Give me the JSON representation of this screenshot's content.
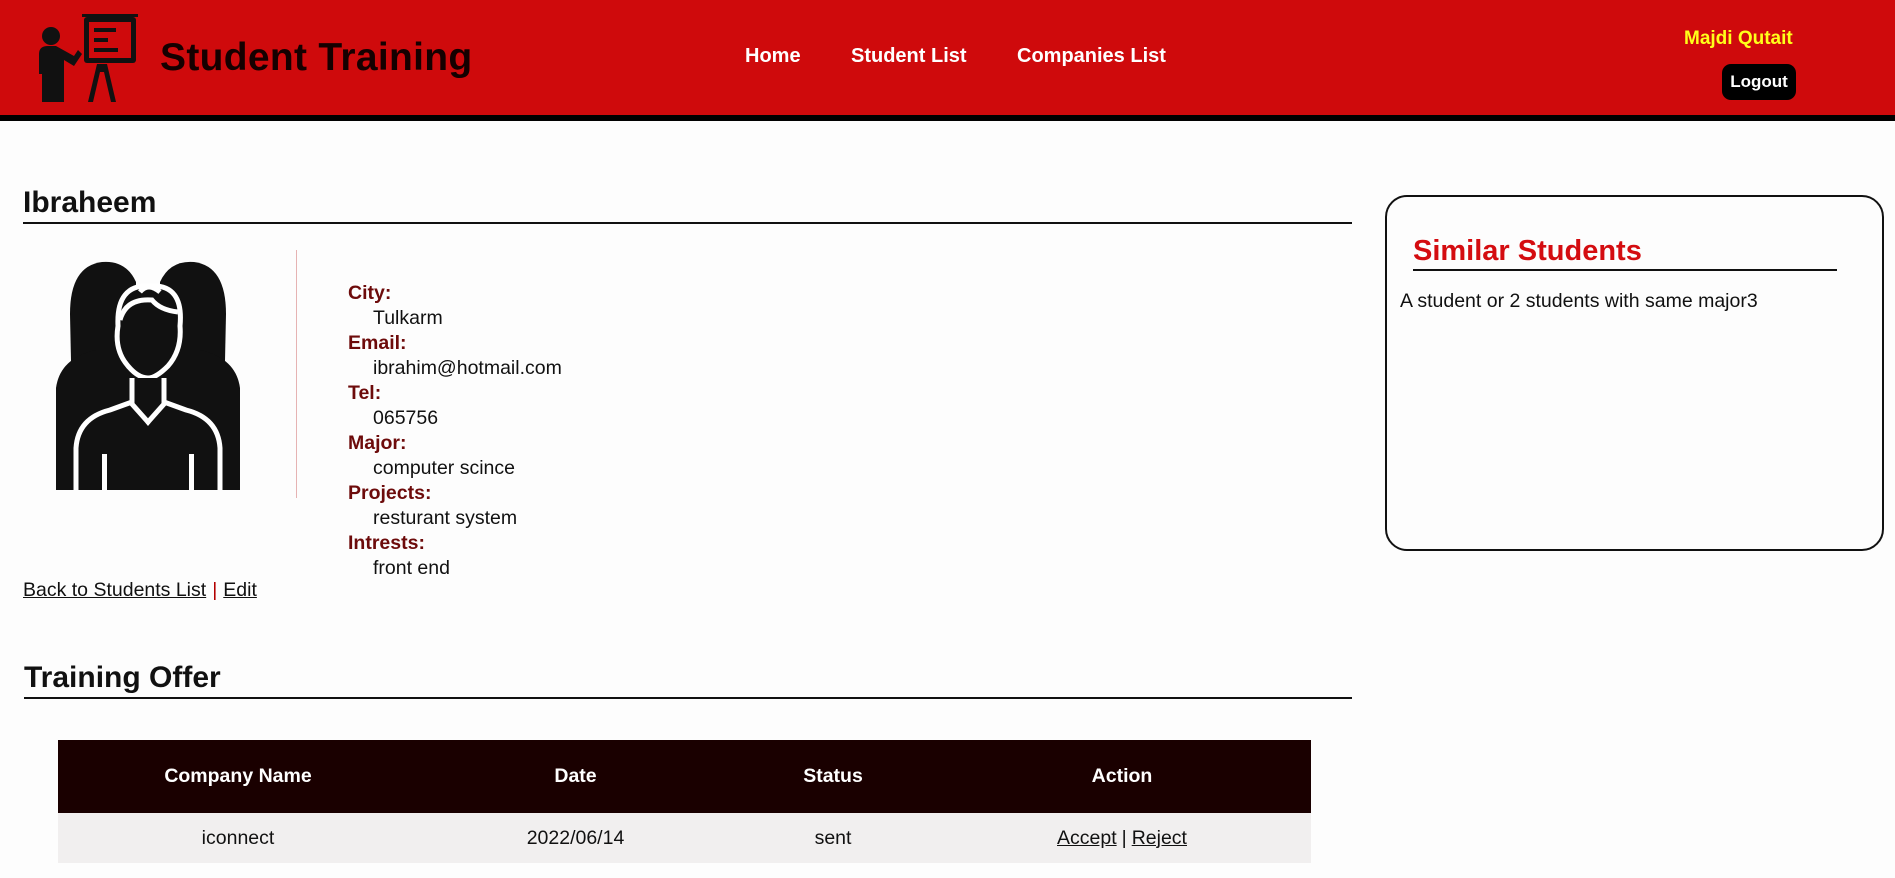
{
  "header": {
    "brand_title": "Student Training",
    "brand_icon": "teacher-presentation-icon",
    "nav": [
      {
        "label": "Home"
      },
      {
        "label": "Student List"
      },
      {
        "label": "Companies List"
      }
    ],
    "user_name": "Majdi Qutait",
    "logout_label": "Logout"
  },
  "profile": {
    "name": "Ibraheem",
    "avatar_icon": "student-group-icon",
    "fields": [
      {
        "label": "City:",
        "value": "Tulkarm"
      },
      {
        "label": "Email:",
        "value": "ibrahim@hotmail.com"
      },
      {
        "label": "Tel:",
        "value": "065756"
      },
      {
        "label": "Major:",
        "value": "computer scince"
      },
      {
        "label": "Projects:",
        "value": "resturant system"
      },
      {
        "label": "Intrests:",
        "value": "front end"
      }
    ],
    "back_link": "Back to Students List",
    "separator": "|",
    "edit_link": "Edit"
  },
  "similar": {
    "title": "Similar Students",
    "text": "A student or 2 students with same major3"
  },
  "training": {
    "title": "Training Offer",
    "columns": [
      "Company Name",
      "Date",
      "Status",
      "Action"
    ],
    "rows": [
      {
        "company": "iconnect",
        "date": "2022/06/14",
        "status": "sent",
        "accept": "Accept",
        "sep": "|",
        "reject": "Reject"
      }
    ]
  },
  "colors": {
    "header_bg": "#cf0a0c",
    "user_name": "#ffff1a",
    "label": "#6d0b0b",
    "similar_title": "#d40c10",
    "table_header_bg": "#1a0000"
  }
}
